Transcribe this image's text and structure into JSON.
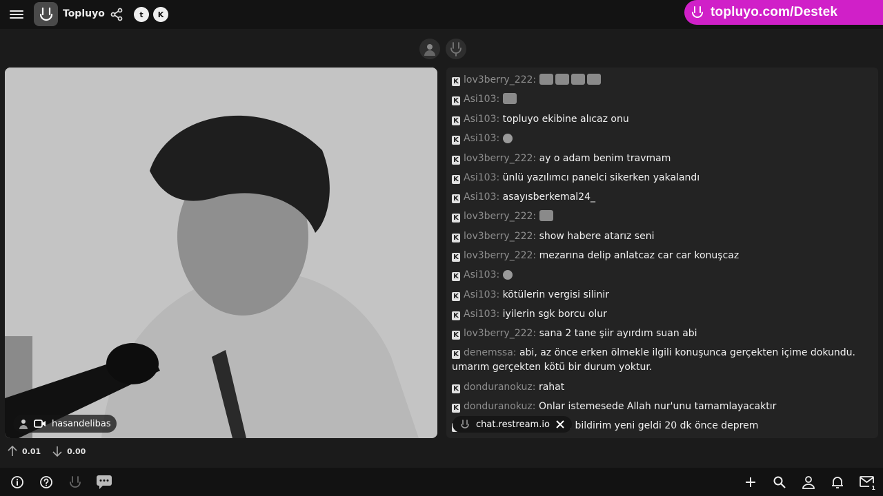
{
  "header": {
    "brand": "Topluyo",
    "twitter_glyph": "t",
    "kick_glyph": "K",
    "promo_text": "topluyo.com/Destek",
    "promo_color": "#d020c8"
  },
  "icons": {
    "menu": "hamburger-icon",
    "logo": "smile-logo-icon",
    "share": "share-icon",
    "twitter": "twitter-icon",
    "kick": "kick-icon"
  },
  "video": {
    "streamer_name": "hasandelibas"
  },
  "chat": {
    "messages": [
      {
        "user": "lov3berry_222:",
        "text": "",
        "emote": "row"
      },
      {
        "user": "Asi103:",
        "text": "",
        "emote": "single"
      },
      {
        "user": "Asi103:",
        "text": "topluyo ekibine alıcaz onu"
      },
      {
        "user": "Asi103:",
        "text": "",
        "emote": "small"
      },
      {
        "user": "lov3berry_222:",
        "text": "ay o adam benim travmam"
      },
      {
        "user": "Asi103:",
        "text": "ünlü yazılımcı panelci sikerken yakalandı"
      },
      {
        "user": "Asi103:",
        "text": "asayısberkemal24_"
      },
      {
        "user": "lov3berry_222:",
        "text": "",
        "emote": "single"
      },
      {
        "user": "lov3berry_222:",
        "text": "show habere atarız seni"
      },
      {
        "user": "lov3berry_222:",
        "text": "mezarına delip anlatcaz car car konuşcaz"
      },
      {
        "user": "Asi103:",
        "text": "",
        "emote": "small"
      },
      {
        "user": "Asi103:",
        "text": "kötülerin vergisi silinir"
      },
      {
        "user": "Asi103:",
        "text": "iyilerin sgk borcu olur"
      },
      {
        "user": "lov3berry_222:",
        "text": "sana 2 tane şiir ayırdım suan abi"
      },
      {
        "user": "denemssa:",
        "text": "abi, az önce erken ölmekle ilgili konuşunca gerçekten içime dokundu. umarım gerçekten kötü bir durum yoktur."
      },
      {
        "user": "donduranokuz:",
        "text": "rahat"
      },
      {
        "user": "donduranokuz:",
        "text": "Onlar istemesede Allah nur'unu tamamlayacaktır"
      },
      {
        "user": "",
        "text": "prem uygulamasından bildirim yeni geldi 20 dk önce deprem"
      }
    ]
  },
  "restream": {
    "label": "chat.restream.io"
  },
  "stats": {
    "up": "0.01",
    "down": "0.00"
  },
  "bottom": {
    "icons": [
      "info-icon",
      "help-icon",
      "smile-icon",
      "chat-icon",
      "plus-icon",
      "search-icon",
      "user-icon",
      "bell-icon",
      "mail-icon"
    ],
    "mail_badge": "1"
  }
}
